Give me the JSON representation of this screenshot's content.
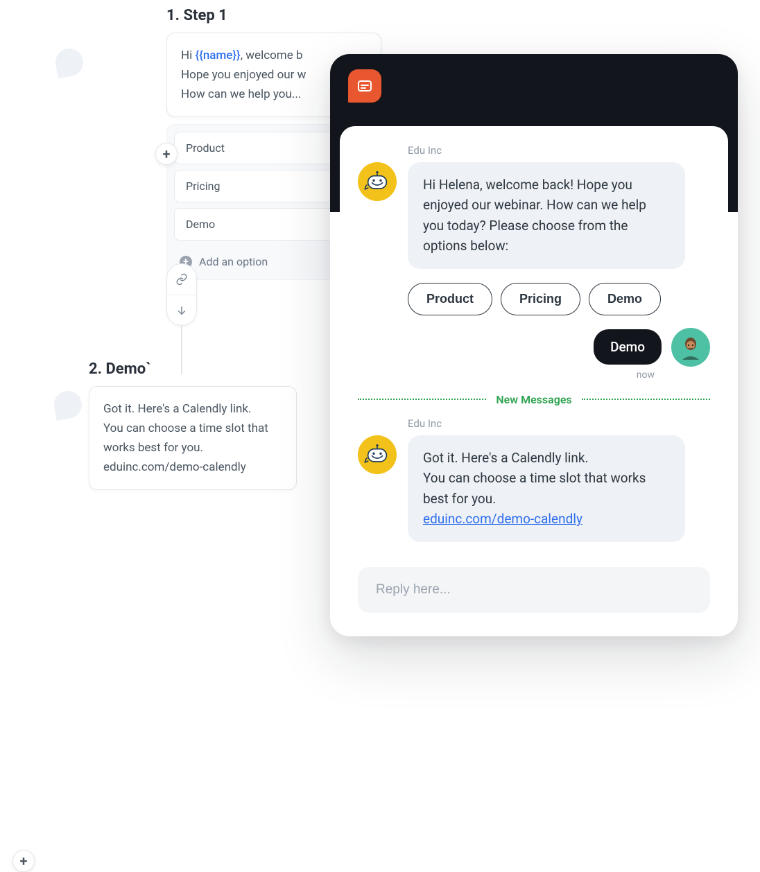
{
  "flow": {
    "step1": {
      "title": "1.  Step 1",
      "message_prefix": "Hi ",
      "token": "{{name}}",
      "message_line1_suffix": ", welcome b",
      "message_line2": "Hope you enjoyed our w",
      "message_line3": "How can we help you...",
      "options": [
        "Product",
        "Pricing",
        "Demo"
      ],
      "add_option_label": "Add an option"
    },
    "step2": {
      "title": "2. Demo`",
      "message_line1": "Got it. Here's a Calendly link.",
      "message_line2": "You can choose a time slot that",
      "message_line3": "works best for you.",
      "message_line4": "eduinc.com/demo-calendly"
    }
  },
  "chat": {
    "sender": "Edu Inc",
    "bot_message_1": "Hi Helena, welcome back! Hope you enjoyed our webinar. How can we help you today? Please choose from the options below:",
    "options": [
      "Product",
      "Pricing",
      "Demo"
    ],
    "user_reply": "Demo",
    "timestamp": "now",
    "divider_label": "New Messages",
    "bot_message_2_line1": "Got it. Here's a Calendly link.",
    "bot_message_2_line2": "You can choose a time slot that works best for you.",
    "bot_message_2_link": "eduinc.com/demo-calendly",
    "reply_placeholder": "Reply here..."
  }
}
